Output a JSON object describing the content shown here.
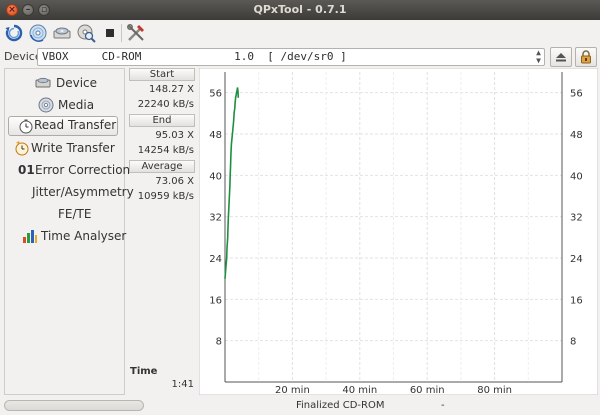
{
  "window": {
    "title": "QPxTool - 0.7.1"
  },
  "toolbar": {
    "icons": [
      "refresh-icon",
      "device-cd-icon",
      "cd-info-icon",
      "cd-search-icon",
      "stop-icon",
      "tools-icon"
    ]
  },
  "device": {
    "label": "Device:",
    "vendor": "VBOX",
    "model": "CD-ROM",
    "firmware": "1.0",
    "path": "[ /dev/sr0 ]",
    "eject_icon": "eject-icon",
    "lock_icon": "lock-icon"
  },
  "nav": {
    "items": [
      {
        "label": "Device",
        "icon": "drive-icon"
      },
      {
        "label": "Media",
        "icon": "disc-icon"
      },
      {
        "label": "Read Transfer",
        "icon": "read-clock-icon"
      },
      {
        "label": "Write Transfer",
        "icon": "write-clock-icon"
      },
      {
        "label": "Error Correction",
        "icon": "binary-icon",
        "prefix": "01"
      },
      {
        "label": "Jitter/Asymmetry"
      },
      {
        "label": "FE/TE"
      },
      {
        "label": "Time Analyser",
        "icon": "bar-chart-icon"
      }
    ],
    "active": "Read Transfer"
  },
  "stats": {
    "start": {
      "header": "Start",
      "speed_x": "148.27 X",
      "speed_kbs": "22240 kB/s"
    },
    "end": {
      "header": "End",
      "speed_x": "95.03 X",
      "speed_kbs": "14254 kB/s"
    },
    "average": {
      "header": "Average",
      "speed_x": "73.06 X",
      "speed_kbs": "10959 kB/s"
    },
    "time": {
      "label": "Time",
      "value": "1:41"
    }
  },
  "chart_data": {
    "type": "line",
    "y_ticks": [
      "8",
      "16",
      "24",
      "32",
      "40",
      "48",
      "56"
    ],
    "x_ticks": [
      "20 min",
      "40 min",
      "60 min",
      "80 min"
    ],
    "ylim": [
      0,
      60
    ],
    "xlim": [
      0,
      100
    ],
    "grid": true,
    "line_color": "#1f8f3f",
    "series": [
      {
        "x": [
          0.0,
          0.25,
          0.5,
          0.6,
          0.7,
          0.8,
          0.9,
          1.0,
          1.15,
          1.3,
          1.45,
          1.55,
          1.65,
          1.75,
          1.9,
          2.05,
          2.2,
          2.35,
          2.5,
          2.6,
          2.7,
          2.8,
          2.9,
          3.0,
          3.15,
          3.3,
          3.45,
          3.6,
          3.7,
          3.85,
          3.95
        ],
        "y": [
          20,
          22,
          24,
          26,
          27,
          28,
          30,
          32,
          34,
          36,
          38,
          40,
          42,
          44,
          46,
          47,
          48,
          49,
          50,
          51,
          52,
          52.5,
          53,
          54,
          55,
          55.5,
          56,
          56.5,
          57,
          56.2,
          55
        ]
      }
    ]
  },
  "status": {
    "progress": 0,
    "text": "Finalized CD-ROM",
    "extra": "-"
  }
}
